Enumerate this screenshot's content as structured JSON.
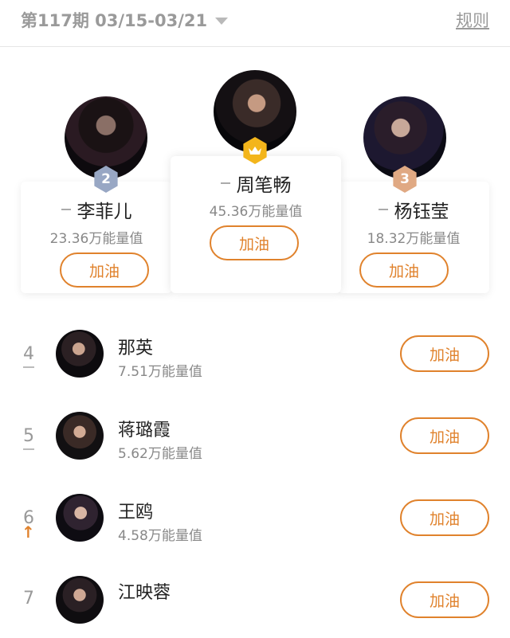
{
  "header": {
    "period": "第117期 03/15-03/21",
    "rules_label": "规则"
  },
  "podium": [
    {
      "rank": "2",
      "name": "李菲儿",
      "energy": "23.36万能量值",
      "button": "加油",
      "trend": "flat"
    },
    {
      "rank": "1",
      "name": "周笔畅",
      "energy": "45.36万能量值",
      "button": "加油",
      "trend": "flat",
      "badge_icon": "crown-icon"
    },
    {
      "rank": "3",
      "name": "杨钰莹",
      "energy": "18.32万能量值",
      "button": "加油",
      "trend": "flat"
    }
  ],
  "list": [
    {
      "rank": "4",
      "name": "那英",
      "energy": "7.51万能量值",
      "button": "加油",
      "trend": "flat"
    },
    {
      "rank": "5",
      "name": "蒋璐霞",
      "energy": "5.62万能量值",
      "button": "加油",
      "trend": "flat"
    },
    {
      "rank": "6",
      "name": "王鸥",
      "energy": "4.58万能量值",
      "button": "加油",
      "trend": "up"
    },
    {
      "rank": "7",
      "name": "江映蓉",
      "energy": "",
      "button": "加油",
      "trend": ""
    }
  ],
  "colors": {
    "accent": "#e0822c",
    "gold": "#f3b51b",
    "silver": "#98a7c4",
    "bronze": "#e0a983"
  }
}
